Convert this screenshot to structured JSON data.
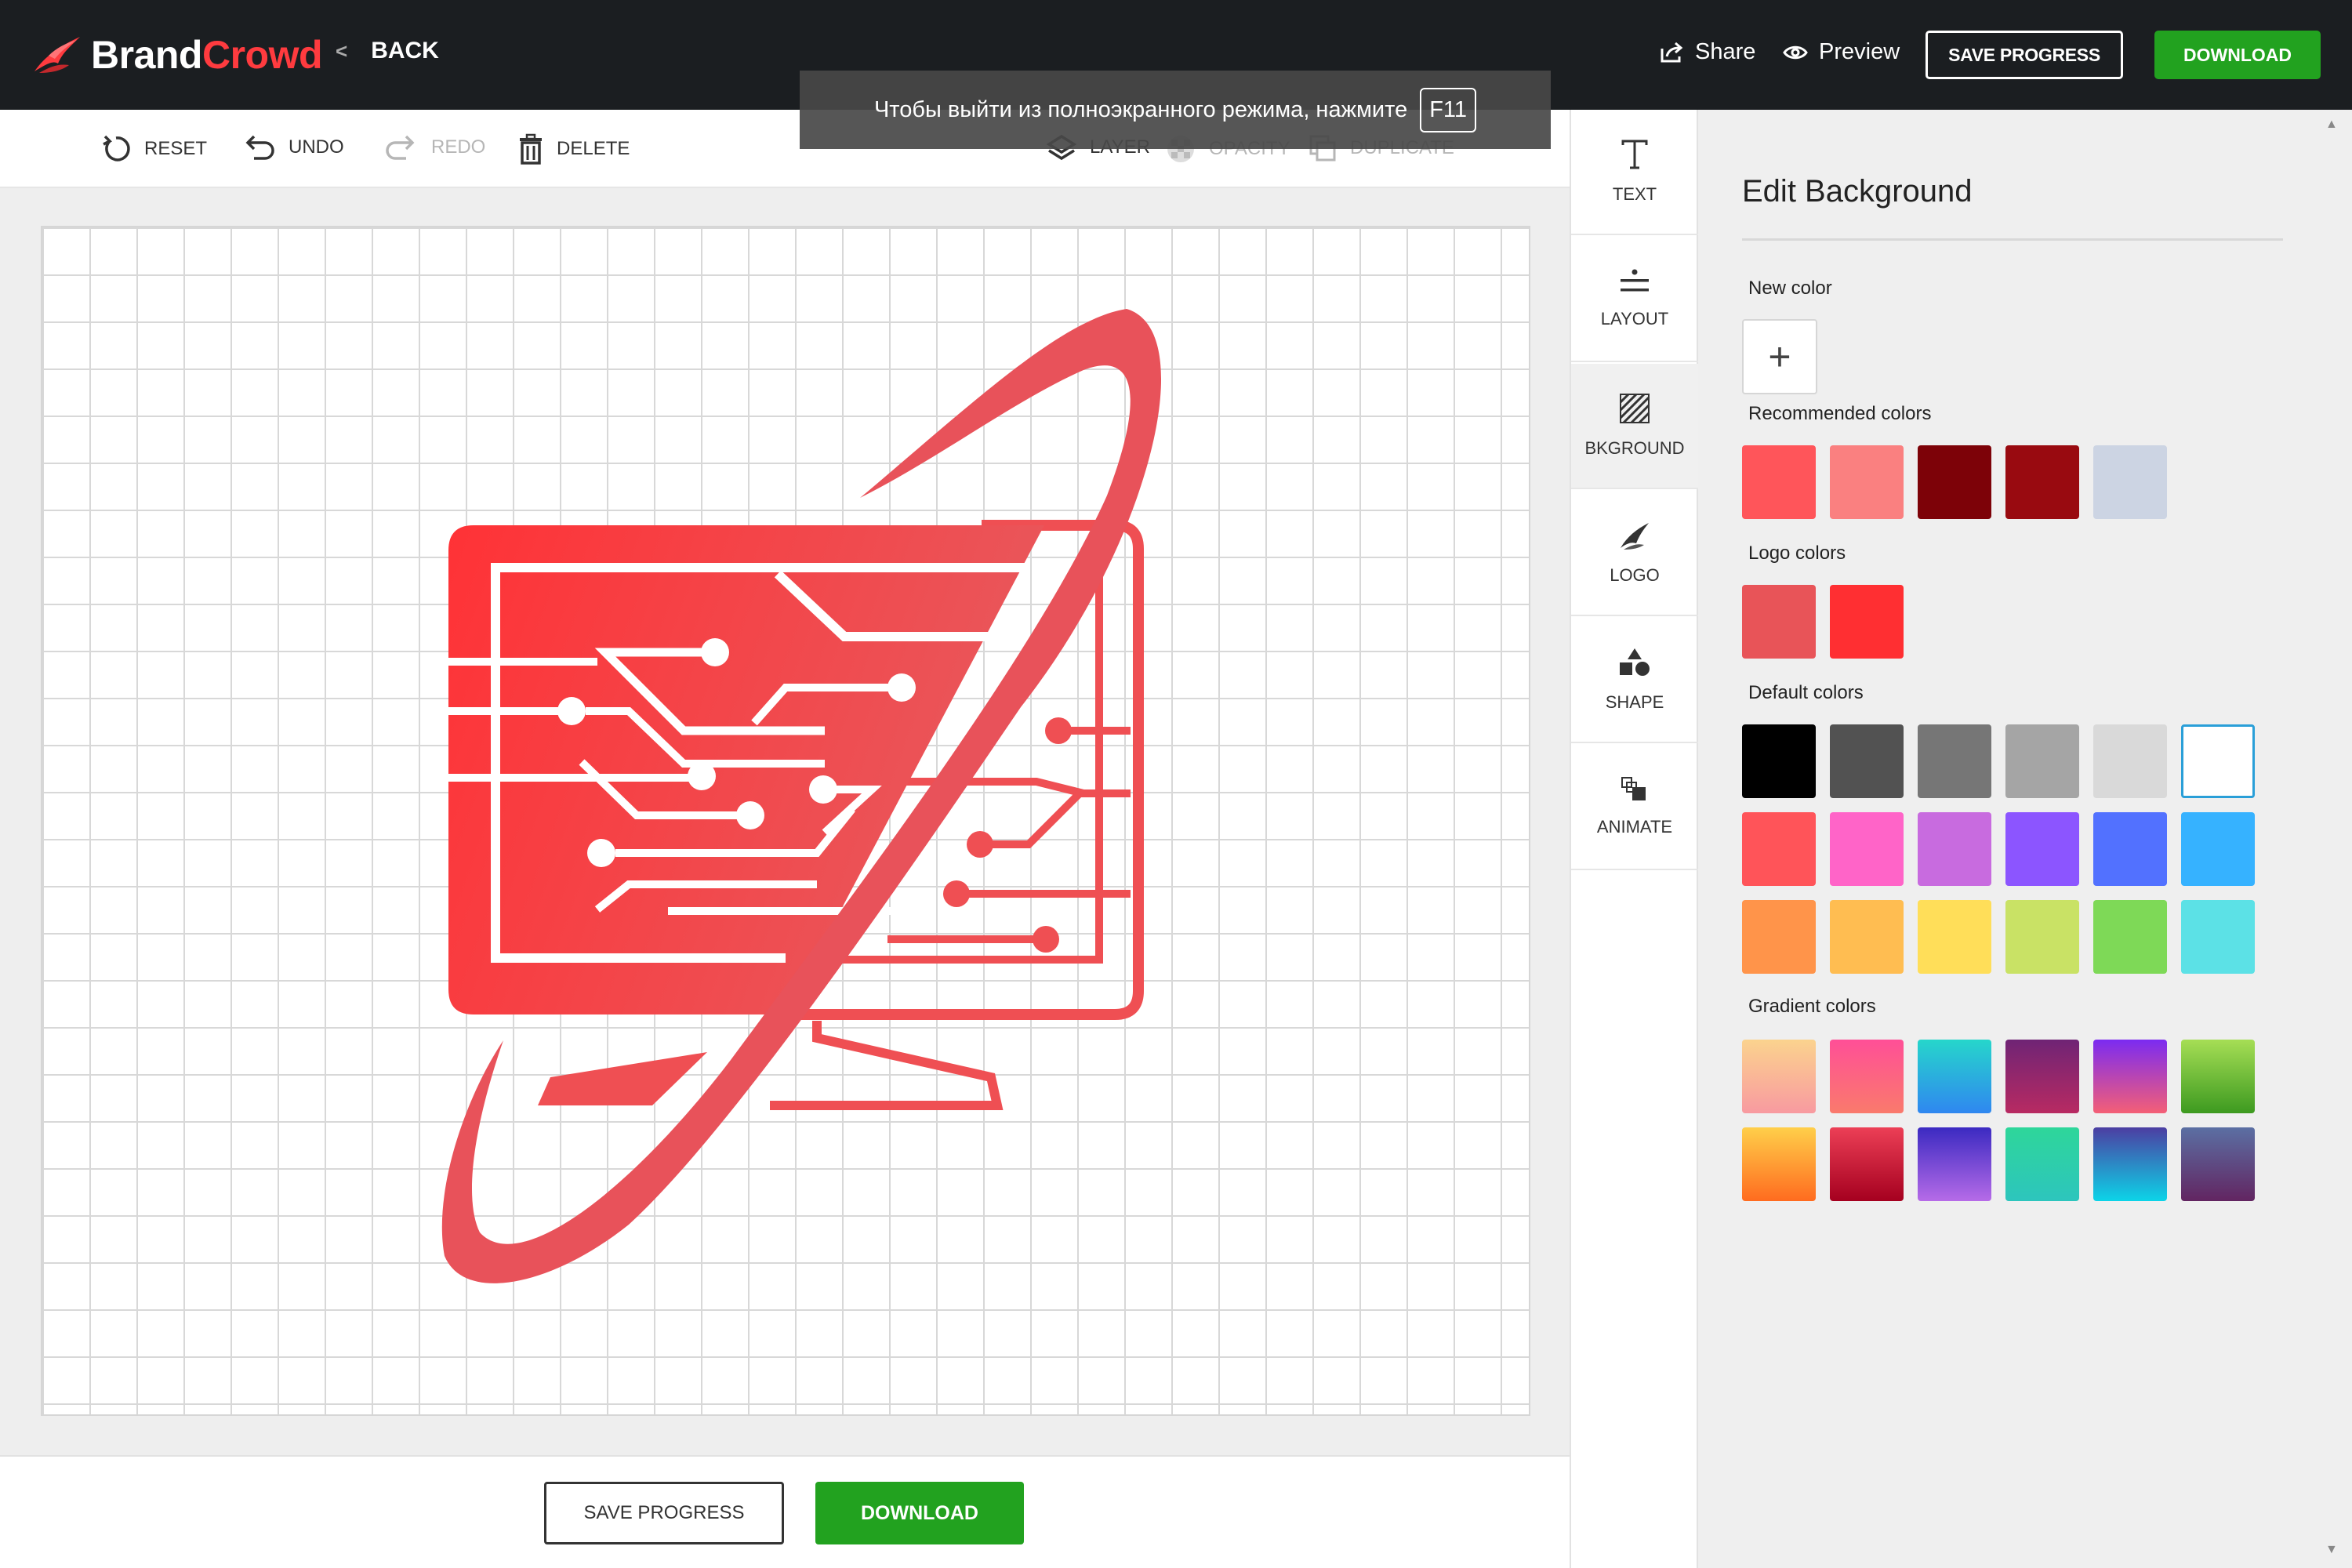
{
  "header": {
    "brand_part1": "Brand",
    "brand_part2": "Crowd",
    "back_label": "BACK",
    "share_label": "Share",
    "preview_label": "Preview",
    "save_progress_label": "SAVE PROGRESS",
    "download_label": "DOWNLOAD"
  },
  "toolbar": {
    "reset": "RESET",
    "undo": "UNDO",
    "redo": "REDO",
    "delete": "DELETE",
    "layer": "LAYER",
    "opacity": "OPACITY",
    "duplicate": "DUPLICATE"
  },
  "toast": {
    "message": "Чтобы выйти из полноэкранного режима, нажмите",
    "key": "F11"
  },
  "rail": {
    "items": [
      {
        "label": "TEXT",
        "icon": "text-icon"
      },
      {
        "label": "LAYOUT",
        "icon": "layout-icon"
      },
      {
        "label": "BKGROUND",
        "icon": "background-icon",
        "active": true
      },
      {
        "label": "LOGO",
        "icon": "logo-icon"
      },
      {
        "label": "SHAPE",
        "icon": "shape-icon"
      },
      {
        "label": "ANIMATE",
        "icon": "animate-icon"
      }
    ]
  },
  "panel": {
    "title": "Edit Background",
    "new_color_label": "New color",
    "new_color_button": "+",
    "recommended_label": "Recommended colors",
    "recommended_colors": [
      "#ff555a",
      "#fa8080",
      "#7d0208",
      "#990a10",
      "#ccd4e3"
    ],
    "logo_label": "Logo colors",
    "logo_colors": [
      "#e85458",
      "#ff2f32"
    ],
    "default_label": "Default colors",
    "default_colors": [
      [
        "#000000",
        "#525252",
        "#767676",
        "#a5a5a5",
        "#d9d9d9",
        "#ffffff"
      ],
      [
        "#ff5459",
        "#ff64c8",
        "#c86bdf",
        "#8c55ff",
        "#5271ff",
        "#36b2ff"
      ],
      [
        "#ff944a",
        "#ffbd51",
        "#ffde59",
        "#c9e265",
        "#7ed957",
        "#5ce1e6"
      ]
    ],
    "selected_default": "#ffffff",
    "gradient_label": "Gradient colors",
    "gradient_colors": [
      [
        "linear-gradient(180deg,#fbd38e,#f89aa0)",
        "linear-gradient(180deg,#ff4f97,#fa7a6c)",
        "linear-gradient(180deg,#26d6cb,#2f87f0)",
        "linear-gradient(180deg,#6f2475,#b82a62)",
        "linear-gradient(180deg,#7b2bf1,#f45f76)",
        "linear-gradient(180deg,#a6de55,#3d9a20)"
      ],
      [
        "linear-gradient(180deg,#ffcf4a,#ff6b1f)",
        "linear-gradient(180deg,#ec3f56,#a5001f)",
        "linear-gradient(180deg,#3b2ac1,#b66be8)",
        "linear-gradient(180deg,#2ed69a,#2dc5bd)",
        "linear-gradient(180deg,#4c3ea2,#0cd4e8)",
        "linear-gradient(180deg,#5b6fa3,#622561)"
      ]
    ]
  },
  "bottom": {
    "save_progress_label": "SAVE PROGRESS",
    "download_label": "DOWNLOAD"
  },
  "colors": {
    "accent_green": "#22a21f",
    "logo_red": "#ff3236",
    "header_bg": "#1b1e21"
  }
}
